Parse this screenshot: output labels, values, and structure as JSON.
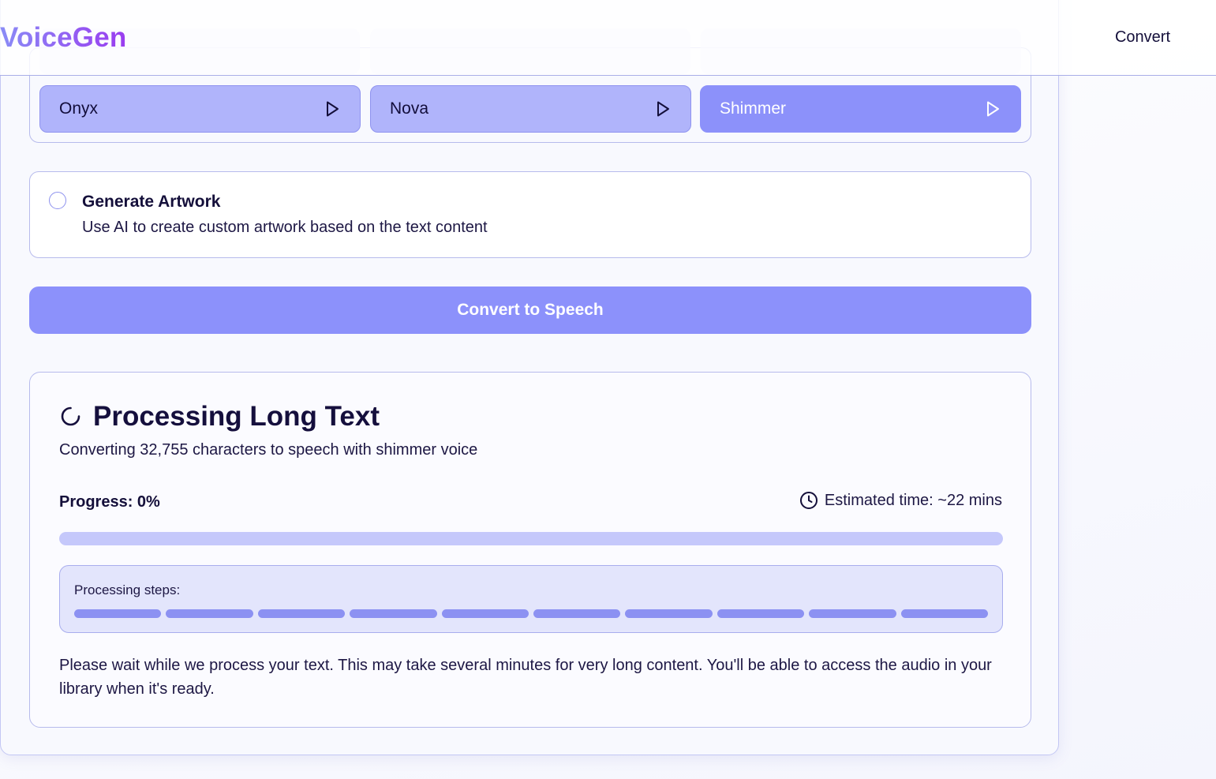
{
  "header": {
    "logo": "VoiceGen",
    "nav_convert": "Convert"
  },
  "voices": [
    {
      "name": "Onyx",
      "selected": false,
      "icon": "play-icon"
    },
    {
      "name": "Nova",
      "selected": false,
      "icon": "play-icon"
    },
    {
      "name": "Shimmer",
      "selected": true,
      "icon": "play-icon"
    }
  ],
  "artwork": {
    "title": "Generate Artwork",
    "description": "Use AI to create custom artwork based on the text content",
    "checked": false
  },
  "convert_button": "Convert to Speech",
  "processing": {
    "title": "Processing Long Text",
    "subtitle": "Converting 32,755 characters to speech with shimmer voice",
    "progress_label": "Progress: 0%",
    "progress_value": 0,
    "eta": "Estimated time: ~22 mins",
    "steps_label": "Processing steps:",
    "step_count": 10,
    "note": "Please wait while we process your text. This may take several minutes for very long content. You'll be able to access the audio in your library when it's ready."
  },
  "colors": {
    "accent": "#8c91fa",
    "accent_light": "#b0b4fb",
    "border": "#b7bbec",
    "text": "#140f3a"
  }
}
